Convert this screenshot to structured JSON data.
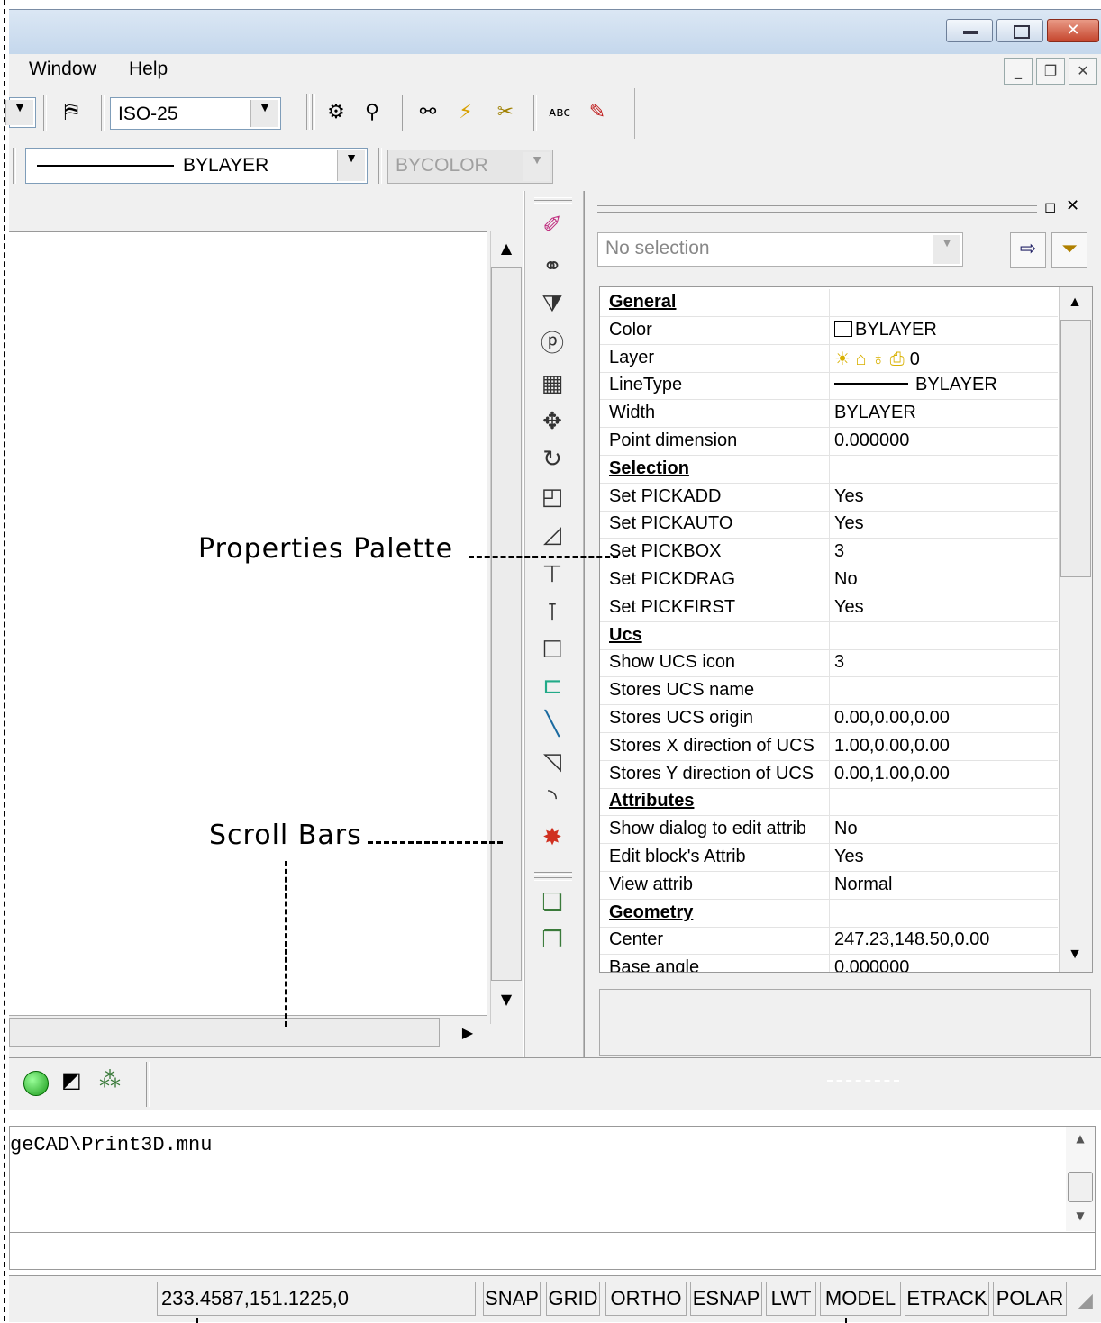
{
  "menu": {
    "window": "Window",
    "help": "Help"
  },
  "toolbar": {
    "dimstyle": "ISO-25",
    "linetype": "BYLAYER",
    "plotstyle": "BYCOLOR"
  },
  "palette": {
    "selection_combo": "No selection",
    "rows": [
      {
        "name": "General",
        "value": "",
        "category": true
      },
      {
        "name": "Color",
        "value": "BYLAYER"
      },
      {
        "name": "Layer",
        "value": "0"
      },
      {
        "name": "LineType",
        "value": "BYLAYER"
      },
      {
        "name": "Width",
        "value": "BYLAYER"
      },
      {
        "name": "Point dimension",
        "value": "0.000000"
      },
      {
        "name": "Selection",
        "value": "",
        "category": true
      },
      {
        "name": "Set PICKADD",
        "value": "Yes"
      },
      {
        "name": "Set PICKAUTO",
        "value": "Yes"
      },
      {
        "name": "Set PICKBOX",
        "value": "3"
      },
      {
        "name": "Set PICKDRAG",
        "value": "No"
      },
      {
        "name": "Set PICKFIRST",
        "value": "Yes"
      },
      {
        "name": "Ucs",
        "value": "",
        "category": true
      },
      {
        "name": "Show UCS icon",
        "value": "3"
      },
      {
        "name": "Stores UCS name",
        "value": ""
      },
      {
        "name": "Stores UCS origin",
        "value": "0.00,0.00,0.00"
      },
      {
        "name": "Stores X direction of UCS",
        "value": "1.00,0.00,0.00"
      },
      {
        "name": "Stores Y direction of UCS",
        "value": "0.00,1.00,0.00"
      },
      {
        "name": "Attributes",
        "value": "",
        "category": true
      },
      {
        "name": "Show dialog to edit attrib",
        "value": "No"
      },
      {
        "name": "Edit block's Attrib",
        "value": "Yes"
      },
      {
        "name": "View attrib",
        "value": "Normal"
      },
      {
        "name": "Geometry",
        "value": "",
        "category": true
      },
      {
        "name": "Center",
        "value": "247.23,148.50,0.00"
      },
      {
        "name": "Base angle",
        "value": "0.000000"
      }
    ]
  },
  "command": {
    "history": "geCAD\\Print3D.mnu",
    "input": ""
  },
  "status": {
    "coords": "233.4587,151.1225,0",
    "buttons": [
      "SNAP",
      "GRID",
      "ORTHO",
      "ESNAP",
      "LWT",
      "MODEL",
      "ETRACK",
      "POLAR"
    ]
  },
  "annotations": {
    "properties": "Properties Palette",
    "scrollbars": "Scroll Bars"
  }
}
